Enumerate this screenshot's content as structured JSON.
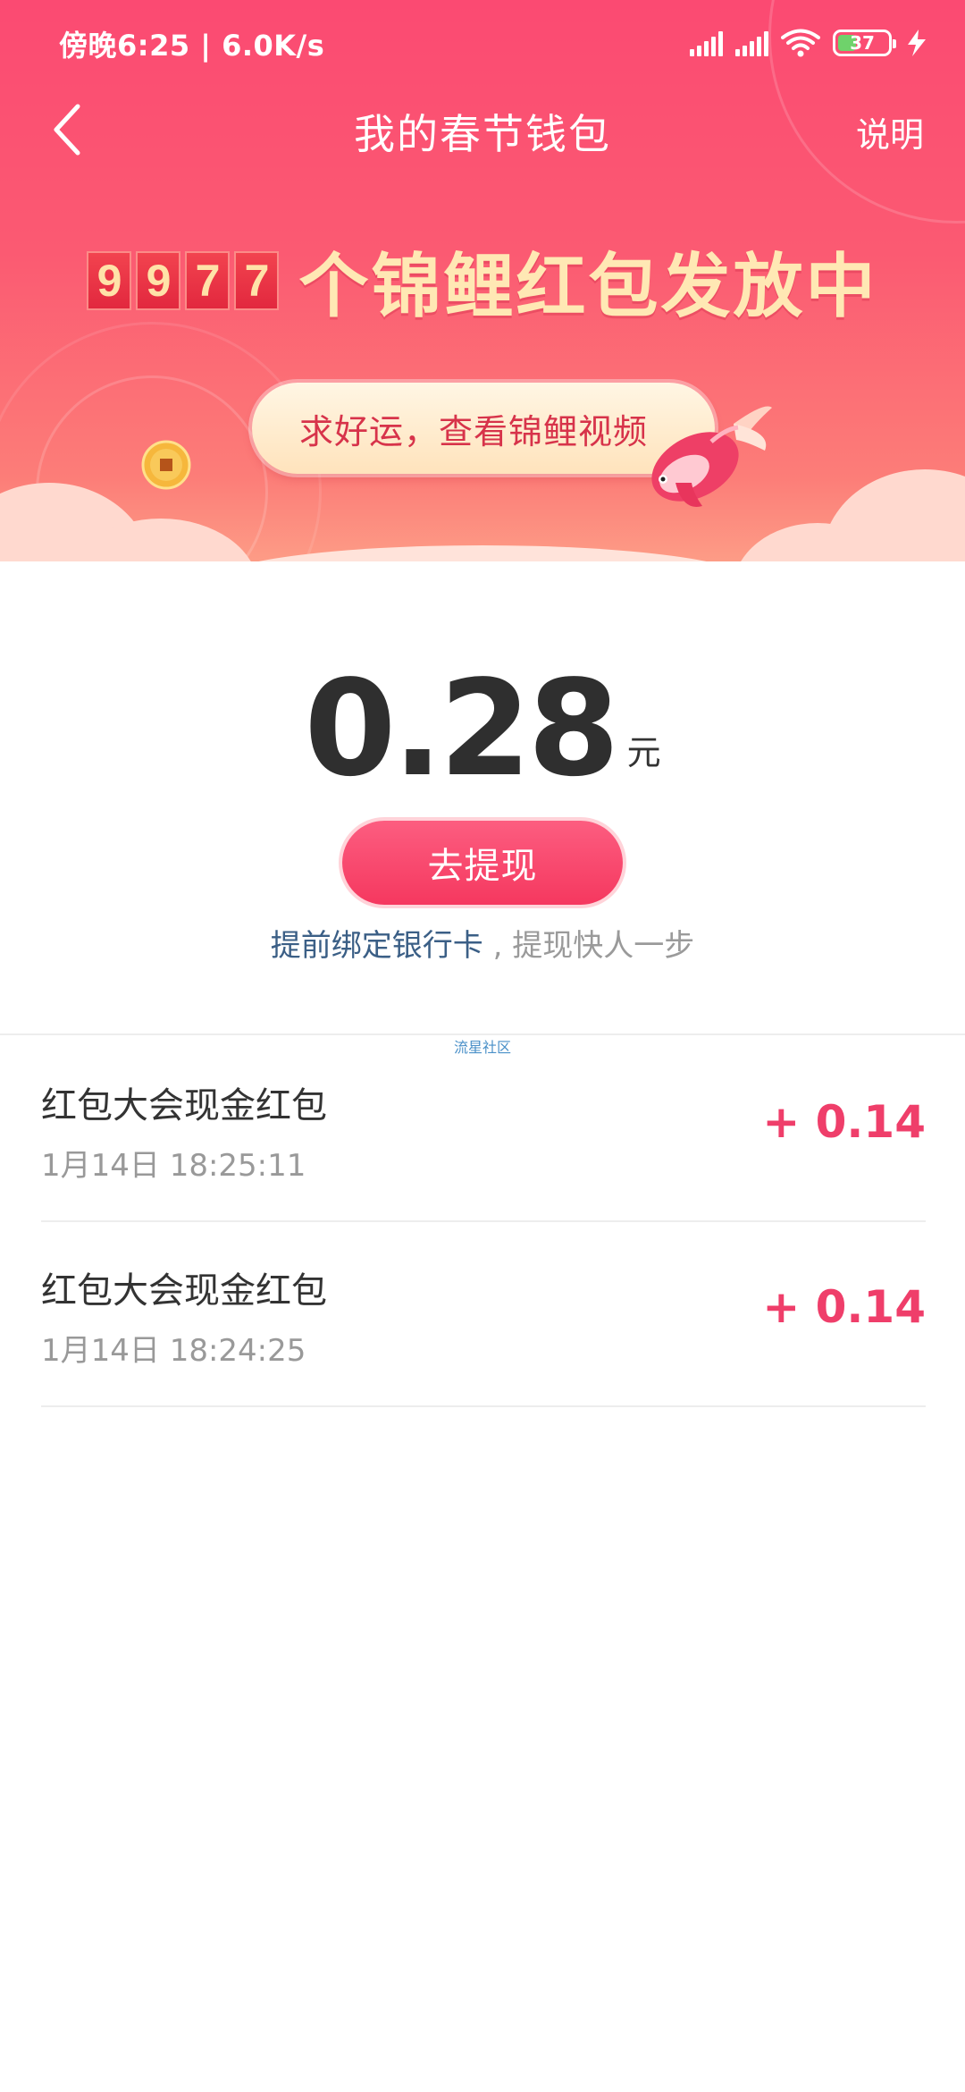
{
  "status_bar": {
    "time_speed": "傍晚6:25 | 6.0K/s",
    "battery_level": "37"
  },
  "nav": {
    "title": "我的春节钱包",
    "explain_label": "说明"
  },
  "banner": {
    "count_digits": [
      "9",
      "9",
      "7",
      "7"
    ],
    "headline": "个锦鲤红包发放中",
    "luck_button_label": "求好运，查看锦鲤视频"
  },
  "balance": {
    "amount": "0.28",
    "unit": "元",
    "withdraw_label": "去提现",
    "bind_link_text": "提前绑定银行卡",
    "bind_suffix_text": " , 提现快人一步"
  },
  "watermark": "流星社区",
  "transactions": [
    {
      "title": "红包大会现金红包",
      "time": "1月14日 18:25:11",
      "amount": "+ 0.14"
    },
    {
      "title": "红包大会现金红包",
      "time": "1月14日 18:24:25",
      "amount": "+ 0.14"
    }
  ],
  "colors": {
    "banner_top": "#fb4a72",
    "headline_gold": "#ffe8b4",
    "accent_pink": "#ef3e6a",
    "link_blue": "#3b5f86"
  }
}
